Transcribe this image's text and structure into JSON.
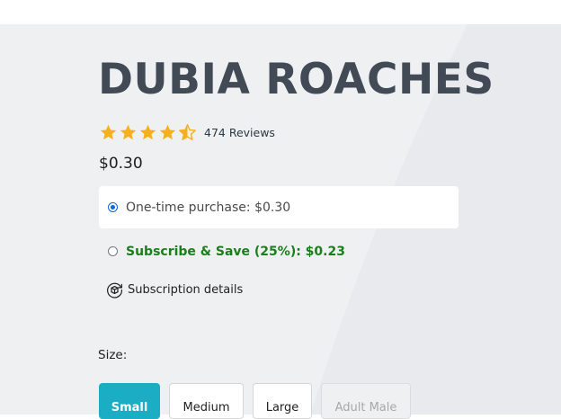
{
  "product": {
    "title": "DUBIA ROACHES",
    "rating": {
      "stars": 4.5,
      "reviews_text": "474 Reviews",
      "star_color": "#f6b01e"
    },
    "price": "$0.30"
  },
  "purchase_options": [
    {
      "label": "One-time purchase: $0.30",
      "checked": true
    },
    {
      "label": "Subscribe & Save (25%): $0.23",
      "checked": false
    }
  ],
  "subscription_details": {
    "icon": "box-cycle-icon",
    "label": "Subscription details"
  },
  "size": {
    "label": "Size:",
    "options": [
      {
        "label": "Small",
        "state": "selected"
      },
      {
        "label": "Medium",
        "state": "available"
      },
      {
        "label": "Large",
        "state": "available"
      },
      {
        "label": "Adult Male",
        "state": "disabled"
      }
    ],
    "accent_color": "#1aadc4"
  },
  "colors": {
    "title": "#414a55",
    "subscribe_green": "#1a7f1a",
    "background": "#eef0f2"
  }
}
